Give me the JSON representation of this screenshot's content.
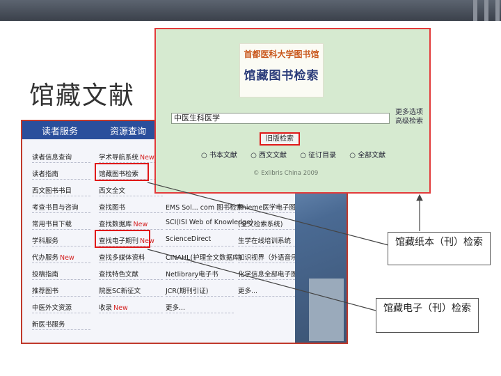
{
  "slide_title": "馆藏文献",
  "portal": {
    "nav_tabs": [
      "读者服务",
      "资源查询"
    ],
    "rows": [
      [
        "读者信息查询",
        "学术导航系统",
        "",
        ""
      ],
      [
        "读者指南",
        "馆藏图书检索",
        "",
        ""
      ],
      [
        "西文图书书目",
        "西文全文",
        "",
        ""
      ],
      [
        "考查书目与咨询",
        "查找图书",
        "EMS Sol... com  图书检索",
        "Thieme医学电子图书"
      ],
      [
        "常用书目下载",
        "查找数据库",
        "SCI(ISI Web of Knowledge)",
        "(全文检索系统)"
      ],
      [
        "学科服务",
        "查找电子期刊",
        "ScienceDirect",
        "生学在线培训系统"
      ],
      [
        "代办服务",
        "查找多媒体资料",
        "CINAHL(护理全文数据库)",
        "知识视界（外语音乐、视"
      ],
      [
        "投稿指南",
        "查找特色文献",
        "Netlibrary电子书",
        "化学信息全部电子图书"
      ],
      [
        "推荐图书",
        "院医SC新征文",
        "JCR(期刊引证)",
        "更多..."
      ],
      [
        "中医外文资源",
        "收录",
        "更多...",
        ""
      ],
      [
        "新医书服务",
        "",
        "",
        ""
      ]
    ],
    "new_badges": [
      {
        "row": 0,
        "col": 1,
        "text": "New"
      },
      {
        "row": 4,
        "col": 1,
        "text": "New"
      },
      {
        "row": 5,
        "col": 1,
        "text": "New"
      },
      {
        "row": 6,
        "col": 0,
        "text": "New"
      },
      {
        "row": 9,
        "col": 1,
        "text": "New"
      }
    ]
  },
  "popup": {
    "logo_line1": "首都医科大学图书馆",
    "logo_line2": "馆藏图书检索",
    "search_value": "中医生科医学",
    "more_options": "更多选项",
    "advanced_search": "高级检索",
    "search_button": "旧版检索",
    "radio_options": [
      "书本文献",
      "西文文献",
      "征订目录",
      "全部文献"
    ],
    "copyright": "© Exlibris China 2009"
  },
  "callouts": {
    "print": "馆藏纸本（刊）检索",
    "electronic": "馆藏电子（刊）检索"
  },
  "colors": {
    "accent_red": "#e01818",
    "nav_blue": "#2a4f9c",
    "popup_green": "#d6ead0"
  }
}
